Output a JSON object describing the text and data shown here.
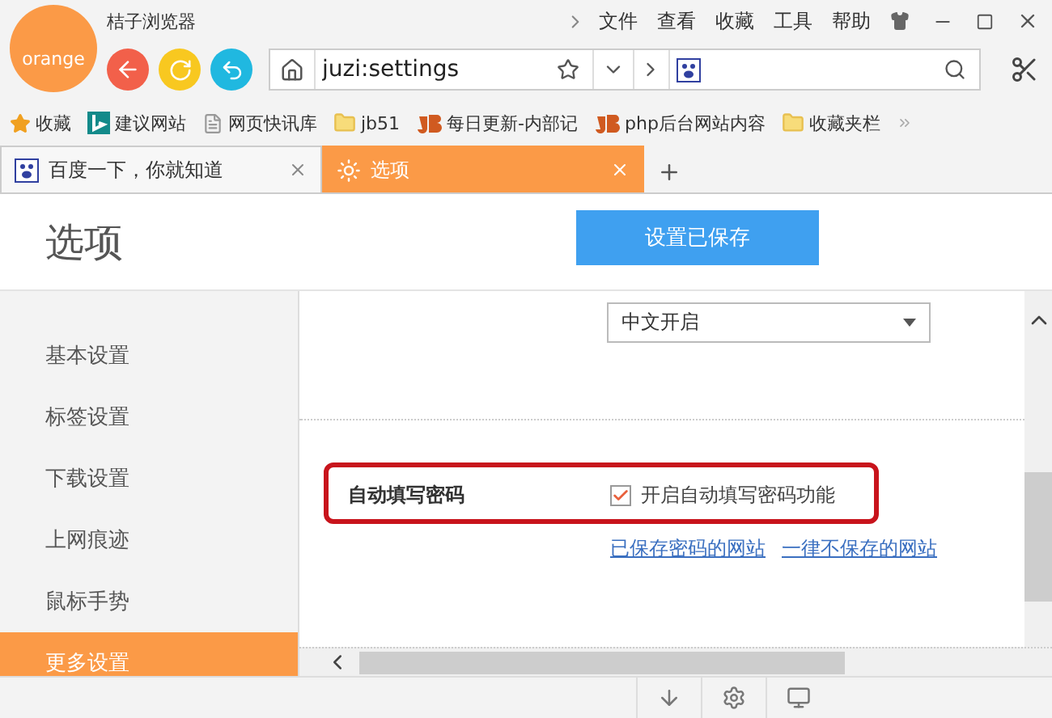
{
  "window": {
    "title": "桔子浏览器",
    "logo": "orange"
  },
  "menu": [
    "文件",
    "查看",
    "收藏",
    "工具",
    "帮助"
  ],
  "address_bar": {
    "value": "juzi:settings"
  },
  "bookmarks": [
    {
      "label": "收藏",
      "kind": "star"
    },
    {
      "label": "建议网站",
      "kind": "bing"
    },
    {
      "label": "网页快讯库",
      "kind": "page"
    },
    {
      "label": "jb51",
      "kind": "folder"
    },
    {
      "label": "每日更新-内部记",
      "kind": "jb"
    },
    {
      "label": "php后台网站内容",
      "kind": "jb"
    },
    {
      "label": "收藏夹栏",
      "kind": "folder"
    }
  ],
  "tabs": [
    {
      "label": "百度一下，你就知道",
      "selected": false,
      "kind": "paw"
    },
    {
      "label": "选项",
      "selected": true,
      "kind": "gear"
    }
  ],
  "page": {
    "title": "选项",
    "save_button": "设置已保存"
  },
  "sidebar": {
    "items": [
      {
        "label": "基本设置",
        "selected": false
      },
      {
        "label": "标签设置",
        "selected": false
      },
      {
        "label": "下载设置",
        "selected": false
      },
      {
        "label": "上网痕迹",
        "selected": false
      },
      {
        "label": "鼠标手势",
        "selected": false
      },
      {
        "label": "更多设置",
        "selected": true
      }
    ]
  },
  "settings": {
    "language_select": {
      "value": "中文开启"
    },
    "autofill": {
      "label": "自动填写密码",
      "checkbox": {
        "label": "开启自动填写密码功能",
        "checked": true
      },
      "links": [
        "已保存密码的网站",
        "一律不保存的网站"
      ]
    }
  }
}
